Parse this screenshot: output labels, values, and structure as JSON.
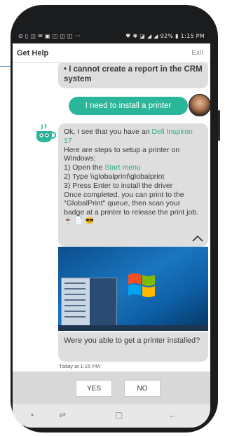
{
  "status_bar": {
    "left_icons": "⊙ ▯ ◫ ✉ ▣ ◫ ◫ ◫ ···",
    "right": "♥ ✱ ◪ ◢ ◢ 92% ▮ 1:15 PM"
  },
  "header": {
    "title": "Get Help",
    "exit_label": "Exit"
  },
  "messages": {
    "prev_bot": "• I cannot create a report in the CRM system",
    "user": "I need to install a printer",
    "bot_main": {
      "line1_prefix": "Ok, I see that you have an ",
      "device": "Dell Inspiron 17",
      "line2": "Here are steps to setup a printer on Windows:",
      "step1_prefix": "1) Open the ",
      "step1_link": "Start menu",
      "step2": "2) Type \\\\globalprint\\globalprint",
      "step3": "3) Press Enter to install the driver",
      "closing": "Once completed, you can print to the \"GlobalPrint\" queue, then scan your badge at a printer to release the print job.",
      "emojis": "☕ 📄 😎"
    },
    "question": "Were you able to get a printer installed?",
    "timestamp": "Today at 1:15 PM"
  },
  "quick_replies": [
    "YES",
    "NO"
  ],
  "nav": {
    "dot": "•",
    "recent": "⇌",
    "home": "▢",
    "back": "←"
  },
  "colors": {
    "accent": "#2bb69a",
    "bubble": "#dedede",
    "frame": "#1b1c1e"
  }
}
